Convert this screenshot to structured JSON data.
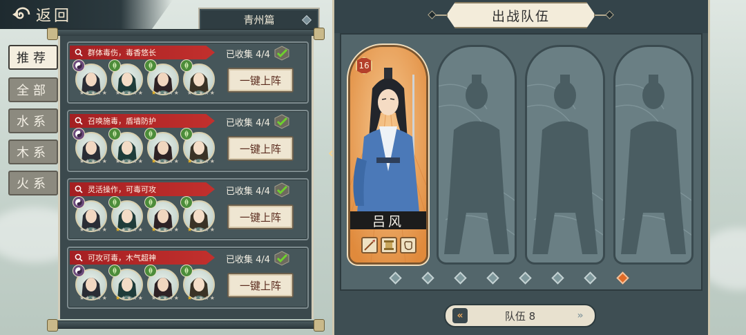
{
  "back": {
    "label": "返回"
  },
  "chapter": {
    "label": "青州篇"
  },
  "filter_tabs": [
    {
      "label": "推荐",
      "active": true
    },
    {
      "label": "全部",
      "active": false
    },
    {
      "label": "水系",
      "active": false
    },
    {
      "label": "木系",
      "active": false
    },
    {
      "label": "火系",
      "active": false
    }
  ],
  "teams": [
    {
      "tag": "群体毒伤，毒香悠长",
      "collected": "已收集 4/4",
      "deploy_label": "一键上阵",
      "heroes": [
        {
          "element": "yinyang-icon",
          "stars": 0
        },
        {
          "element": "leaf-icon",
          "stars": 0
        },
        {
          "element": "leaf-icon",
          "stars": 1
        },
        {
          "element": "leaf-icon",
          "stars": 0
        }
      ]
    },
    {
      "tag": "召唤施毒，盾墙防护",
      "collected": "已收集 4/4",
      "deploy_label": "一键上阵",
      "heroes": [
        {
          "element": "yinyang-icon",
          "stars": 0
        },
        {
          "element": "leaf-icon",
          "stars": 0
        },
        {
          "element": "leaf-icon",
          "stars": 1
        },
        {
          "element": "leaf-icon",
          "stars": 1
        }
      ]
    },
    {
      "tag": "灵活操作，可毒可攻",
      "collected": "已收集 4/4",
      "deploy_label": "一键上阵",
      "heroes": [
        {
          "element": "yinyang-icon",
          "stars": 0
        },
        {
          "element": "leaf-icon",
          "stars": 1
        },
        {
          "element": "leaf-icon",
          "stars": 1
        },
        {
          "element": "leaf-icon",
          "stars": 1
        }
      ]
    },
    {
      "tag": "可攻可毒，木气超神",
      "collected": "已收集 4/4",
      "deploy_label": "一键上阵",
      "heroes": [
        {
          "element": "yinyang-icon",
          "stars": 0
        },
        {
          "element": "leaf-icon",
          "stars": 1
        },
        {
          "element": "leaf-icon",
          "stars": 0
        },
        {
          "element": "leaf-icon",
          "stars": 1
        }
      ]
    }
  ],
  "formation": {
    "title": "出战队伍",
    "hero": {
      "name": "吕风",
      "level": "16"
    },
    "empty_slots": 3,
    "page_dots": 8,
    "active_dot": 8,
    "team_label": "队伍 8"
  },
  "colors": {
    "panel": "#3e4e53",
    "tag_red": "#b82a28",
    "accent_orange": "#e06b27",
    "leaf_green": "#4c8c3a"
  }
}
